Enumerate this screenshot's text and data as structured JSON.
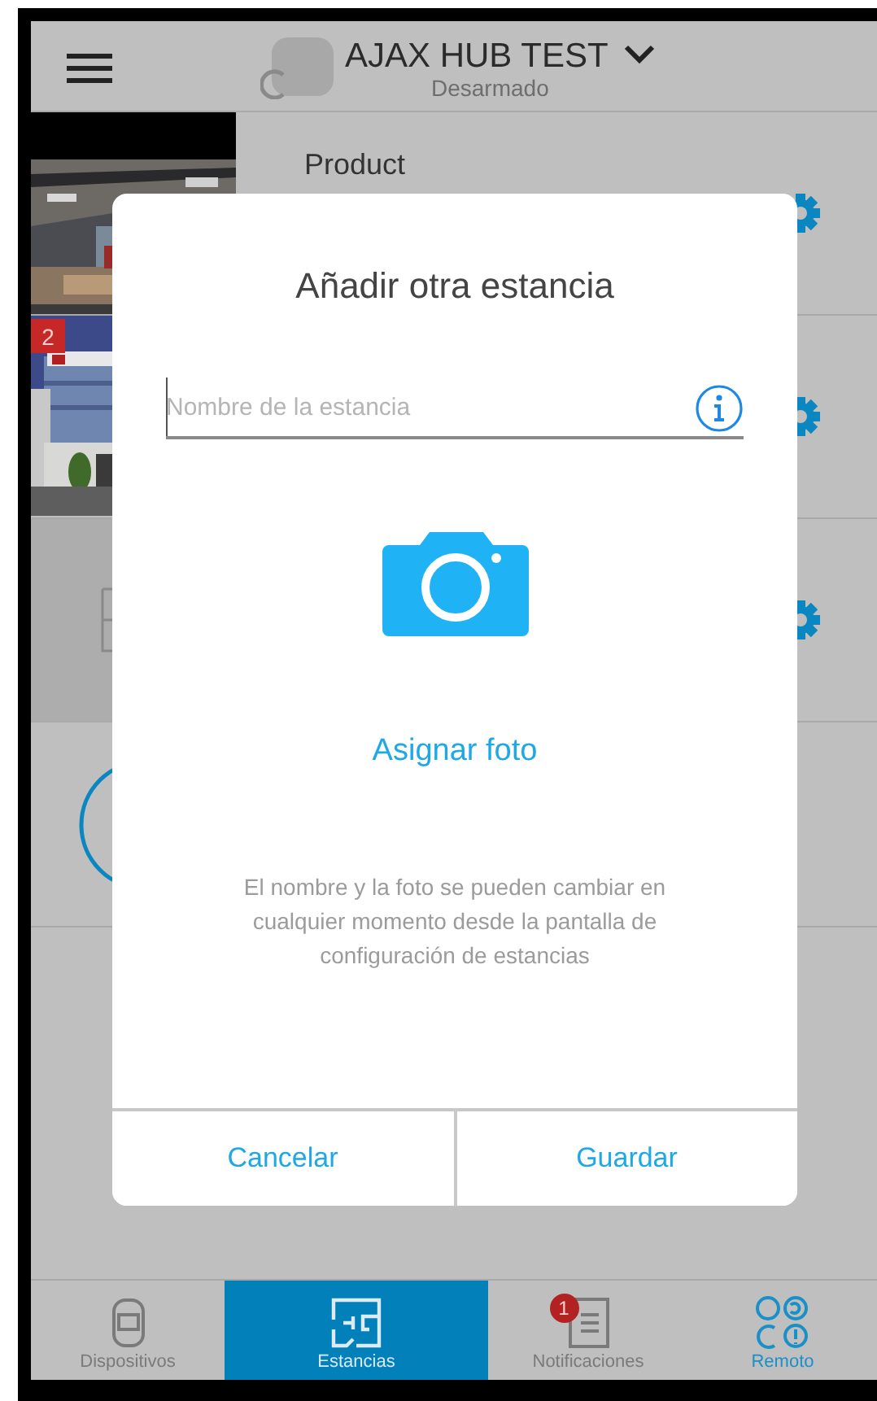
{
  "header": {
    "title": "AJAX HUB TEST",
    "subtitle": "Desarmado"
  },
  "rooms": [
    {
      "name": "Product"
    },
    {
      "badge": "2"
    },
    {
      "kind": "empty"
    }
  ],
  "dialog": {
    "title": "Añadir otra estancia",
    "field": {
      "placeholder": "Nombre de la estancia"
    },
    "photo_link": "Asignar foto",
    "note": "El nombre y la foto se pueden cambiar en cualquier momento desde la pantalla de configuración de estancias",
    "buttons": [
      "Cancelar",
      "Guardar"
    ]
  },
  "tabs": [
    {
      "kind": "devices",
      "label": "Dispositivos",
      "selected": false
    },
    {
      "kind": "rooms",
      "label": "Estancias",
      "selected": true
    },
    {
      "kind": "notifications",
      "label": "Notificaciones",
      "selected": false,
      "badge": "1"
    },
    {
      "kind": "remote",
      "label": "Remoto",
      "selected": false
    }
  ]
}
